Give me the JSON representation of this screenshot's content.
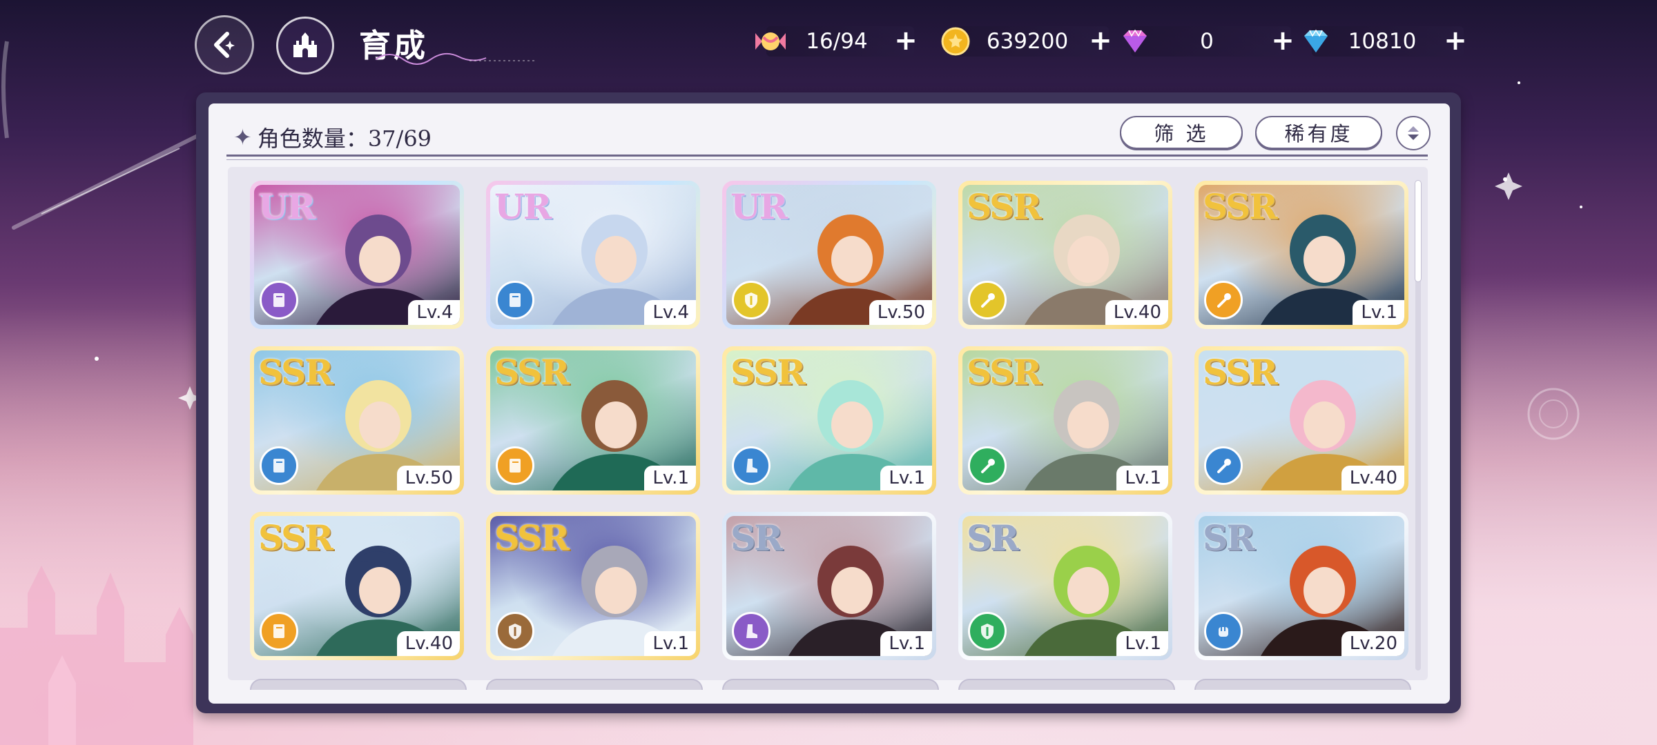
{
  "header": {
    "title": "育成"
  },
  "resources": [
    {
      "icon": "candy-icon",
      "value": "16/94"
    },
    {
      "icon": "gold-coin-icon",
      "value": "639200"
    },
    {
      "icon": "pink-gem-icon",
      "value": "0"
    },
    {
      "icon": "blue-diamond-icon",
      "value": "10810"
    }
  ],
  "panel": {
    "count_label": "角色数量：37/69",
    "filter_label": "筛 选",
    "rarity_label": "稀有度"
  },
  "colors": {
    "role_purple": "#8a5bc7",
    "role_blue": "#3a86d1",
    "role_yellow": "#e3c52a",
    "role_orange": "#f0a024",
    "role_green": "#2fae5e",
    "role_brown": "#9a6a3a"
  },
  "cards": [
    {
      "rarity": "UR",
      "level": "Lv.4",
      "role": "purple",
      "role_icon": "book-icon"
    },
    {
      "rarity": "UR",
      "level": "Lv.4",
      "role": "blue",
      "role_icon": "book-icon"
    },
    {
      "rarity": "UR",
      "level": "Lv.50",
      "role": "yellow",
      "role_icon": "shield-icon"
    },
    {
      "rarity": "SSR",
      "level": "Lv.40",
      "role": "yellow",
      "role_icon": "wand-icon"
    },
    {
      "rarity": "SSR",
      "level": "Lv.1",
      "role": "orange",
      "role_icon": "wand-icon"
    },
    {
      "rarity": "SSR",
      "level": "Lv.50",
      "role": "blue",
      "role_icon": "book-icon"
    },
    {
      "rarity": "SSR",
      "level": "Lv.1",
      "role": "orange",
      "role_icon": "book-icon"
    },
    {
      "rarity": "SSR",
      "level": "Lv.1",
      "role": "blue",
      "role_icon": "boot-icon"
    },
    {
      "rarity": "SSR",
      "level": "Lv.1",
      "role": "green",
      "role_icon": "wand-icon"
    },
    {
      "rarity": "SSR",
      "level": "Lv.40",
      "role": "blue",
      "role_icon": "wand-icon"
    },
    {
      "rarity": "SSR",
      "level": "Lv.40",
      "role": "orange",
      "role_icon": "book-icon"
    },
    {
      "rarity": "SSR",
      "level": "Lv.1",
      "role": "brown",
      "role_icon": "shield-icon"
    },
    {
      "rarity": "SR",
      "level": "Lv.1",
      "role": "purple",
      "role_icon": "boot-icon"
    },
    {
      "rarity": "SR",
      "level": "Lv.1",
      "role": "green",
      "role_icon": "shield-icon"
    },
    {
      "rarity": "SR",
      "level": "Lv.20",
      "role": "blue",
      "role_icon": "fist-icon"
    }
  ]
}
